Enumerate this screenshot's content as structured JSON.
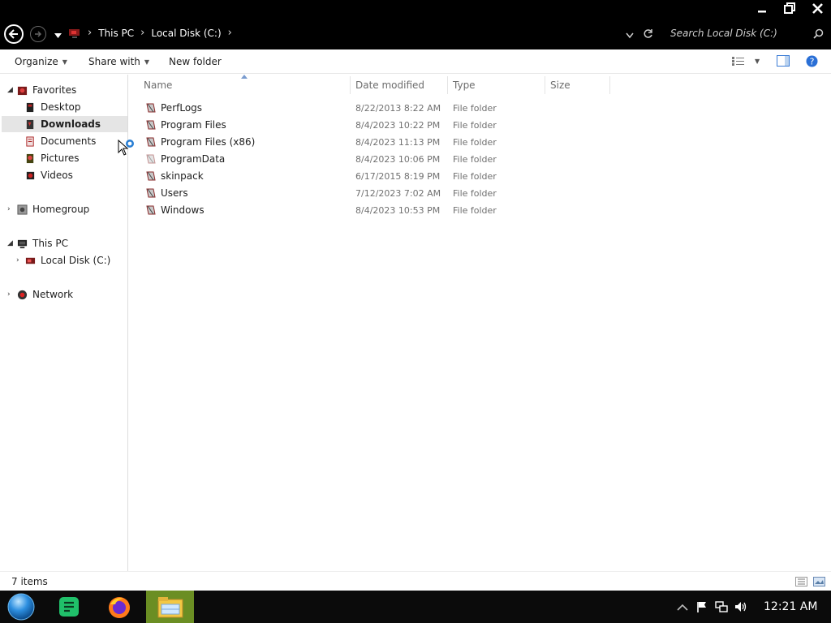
{
  "window": {
    "controls": [
      "minimize-icon",
      "restore-icon",
      "close-icon"
    ]
  },
  "address_bar": {
    "breadcrumbs": [
      "This PC",
      "Local Disk (C:)"
    ],
    "search_placeholder": "Search Local Disk (C:)"
  },
  "toolbar": {
    "organize": "Organize",
    "share_with": "Share with",
    "new_folder": "New folder"
  },
  "nav": {
    "favorites": "Favorites",
    "favorites_items": [
      "Desktop",
      "Downloads",
      "Documents",
      "Pictures",
      "Videos"
    ],
    "selected": "Downloads",
    "homegroup": "Homegroup",
    "this_pc": "This PC",
    "this_pc_items": [
      "Local Disk (C:)"
    ],
    "network": "Network"
  },
  "columns": [
    "Name",
    "Date modified",
    "Type",
    "Size"
  ],
  "files": [
    {
      "name": "PerfLogs",
      "date": "8/22/2013 8:22 AM",
      "type": "File folder"
    },
    {
      "name": "Program Files",
      "date": "8/4/2023 10:22 PM",
      "type": "File folder"
    },
    {
      "name": "Program Files (x86)",
      "date": "8/4/2023 11:13 PM",
      "type": "File folder"
    },
    {
      "name": "ProgramData",
      "date": "8/4/2023 10:06 PM",
      "type": "File folder"
    },
    {
      "name": "skinpack",
      "date": "6/17/2015 8:19 PM",
      "type": "File folder"
    },
    {
      "name": "Users",
      "date": "7/12/2023 7:02 AM",
      "type": "File folder"
    },
    {
      "name": "Windows",
      "date": "8/4/2023 10:53 PM",
      "type": "File folder"
    }
  ],
  "status": {
    "item_count": "7 items"
  },
  "taskbar": {
    "apps": [
      "start-orb-icon",
      "notes-app-icon",
      "firefox-icon",
      "file-explorer-icon"
    ],
    "active_app": "file-explorer-icon",
    "tray": [
      "show-hidden-icons-icon",
      "action-center-flag-icon",
      "network-icon",
      "volume-icon"
    ],
    "clock": "12:21 AM"
  },
  "colors": {
    "topbar": "#000000",
    "taskbar": "#0b0b0b",
    "active_app_bg": "#6b8e23",
    "selection": "#e5e5e5",
    "accent": "#2a7fd4"
  }
}
